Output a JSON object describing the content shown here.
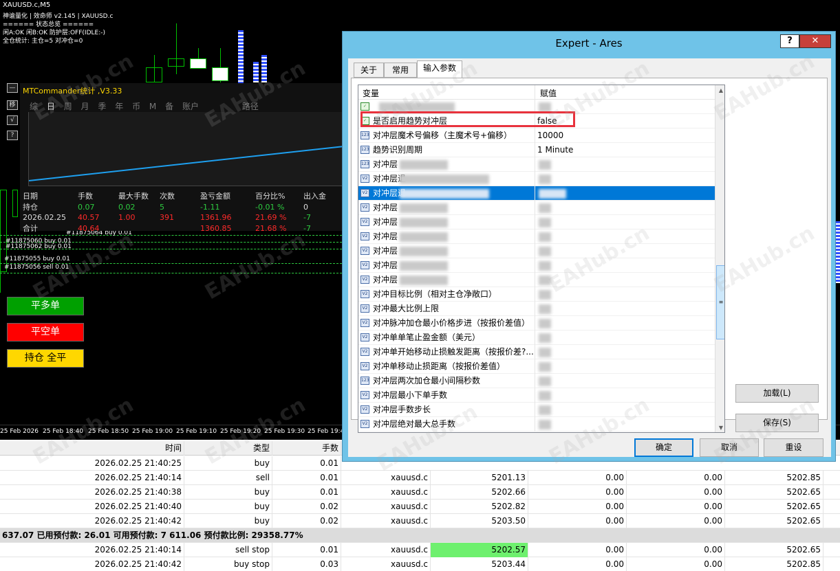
{
  "chart": {
    "title": "XAUUSD.c,M5",
    "info_lines": [
      "神谕量化 | 效命师 v2.145 | XAUUSD.c",
      "====== 状态总览 ======",
      "闲A:OK  闲B:OK  防护层:OFF(IDLE:-)",
      "全仓统计: 主仓=5  对冲仓=0"
    ],
    "side_buttons": [
      "—",
      "移",
      "√",
      "?"
    ],
    "order_labels": [
      "#11875064 buy 0.01",
      "#11875060 buy 0.01",
      "#11875062 buy 0.01",
      "#11875055 buy 0.01",
      "#11875056 sell 0.01"
    ],
    "action_buttons": {
      "close_long": "平多单",
      "close_short": "平空单",
      "close_all": "持仓  全平"
    },
    "time_ticks": [
      "25 Feb 2026",
      "25 Feb 18:40",
      "25 Feb 18:50",
      "25 Feb 19:00",
      "25 Feb 19:10",
      "25 Feb 19:20",
      "25 Feb 19:30",
      "25 Feb 19:4"
    ],
    "colors": {
      "bull": "#00c000",
      "close_long_btn": "#00a000",
      "close_short_btn": "#ff0000",
      "close_all_btn": "#ffd700"
    }
  },
  "stats": {
    "title": "MTCommander统计 ,V3.33",
    "tabs": [
      "综",
      "日",
      "周",
      "月",
      "季",
      "年",
      "币",
      "M",
      "备",
      "账户",
      "",
      "路径"
    ],
    "active_tab": "日",
    "headers": [
      "日期",
      "手数",
      "最大手数",
      "次数",
      "盈亏金额",
      "百分比%",
      "出入金"
    ],
    "rows": [
      {
        "date": "持仓",
        "lots": "0.07",
        "max_lots": "0.02",
        "count": "5",
        "pnl": "-1.11",
        "pct": "-0.01 %",
        "flow": "0"
      },
      {
        "date": "2026.02.25",
        "lots": "40.57",
        "max_lots": "1.00",
        "count": "391",
        "pnl": "1361.96",
        "pct": "21.69 %",
        "flow": "-7"
      },
      {
        "date": "合计",
        "lots": "40.64",
        "max_lots": "",
        "count": "",
        "pnl": "1360.85",
        "pct": "21.68 %",
        "flow": "-7"
      }
    ]
  },
  "trade": {
    "headers": [
      "时间",
      "类型",
      "手数"
    ],
    "rows": [
      {
        "time": "2026.02.25 21:40:25",
        "type": "buy",
        "lots": "0.01",
        "symbol": "",
        "price": "",
        "sl": "",
        "tp": "",
        "cur": ""
      },
      {
        "time": "2026.02.25 21:40:14",
        "type": "sell",
        "lots": "0.01",
        "symbol": "xauusd.c",
        "price": "5201.13",
        "sl": "0.00",
        "tp": "0.00",
        "cur": "5202.85"
      },
      {
        "time": "2026.02.25 21:40:38",
        "type": "buy",
        "lots": "0.01",
        "symbol": "xauusd.c",
        "price": "5202.66",
        "sl": "0.00",
        "tp": "0.00",
        "cur": "5202.65"
      },
      {
        "time": "2026.02.25 21:40:40",
        "type": "buy",
        "lots": "0.02",
        "symbol": "xauusd.c",
        "price": "5202.82",
        "sl": "0.00",
        "tp": "0.00",
        "cur": "5202.65"
      },
      {
        "time": "2026.02.25 21:40:42",
        "type": "buy",
        "lots": "0.02",
        "symbol": "xauusd.c",
        "price": "5203.50",
        "sl": "0.00",
        "tp": "0.00",
        "cur": "5202.65"
      }
    ],
    "summary": "637.07  已用预付款: 26.01  可用预付款: 7 611.06  预付款比例: 29358.77%",
    "pending": [
      {
        "time": "2026.02.25 21:40:14",
        "type": "sell stop",
        "lots": "0.01",
        "symbol": "xauusd.c",
        "price": "5202.57",
        "sl": "0.00",
        "tp": "0.00",
        "cur": "5202.65"
      },
      {
        "time": "2026.02.25 21:40:42",
        "type": "buy stop",
        "lots": "0.03",
        "symbol": "xauusd.c",
        "price": "5203.44",
        "sl": "0.00",
        "tp": "0.00",
        "cur": "5202.85"
      }
    ]
  },
  "dialog": {
    "title": "Expert - Ares",
    "help": "?",
    "close": "✕",
    "tabs": [
      "关于",
      "常用",
      "输入参数"
    ],
    "active_tab": "输入参数",
    "grid_headers": {
      "name": "变量",
      "value": "赋值"
    },
    "params": [
      {
        "icon": "bool",
        "name": "",
        "value": ""
      },
      {
        "icon": "bool",
        "name": "是否启用趋势对冲层",
        "value": "false"
      },
      {
        "icon": "123",
        "name": "对冲层魔术号偏移（主魔术号+偏移）",
        "value": "10000"
      },
      {
        "icon": "123",
        "name": "趋势识别周期",
        "value": "1 Minute"
      },
      {
        "icon": "123",
        "name": "对冲层",
        "value": ""
      },
      {
        "icon": "V2",
        "name": "对冲层退",
        "value": ""
      },
      {
        "icon": "V2",
        "name": "对冲层退",
        "value": ""
      },
      {
        "icon": "V2",
        "name": "对冲层",
        "value": ""
      },
      {
        "icon": "V2",
        "name": "对冲层",
        "value": ""
      },
      {
        "icon": "V2",
        "name": "对冲层",
        "value": ""
      },
      {
        "icon": "V2",
        "name": "对冲层",
        "value": ""
      },
      {
        "icon": "V2",
        "name": "对冲层",
        "value": ""
      },
      {
        "icon": "V2",
        "name": "对冲层",
        "value": ""
      },
      {
        "icon": "V2",
        "name": "对冲目标比例（相对主仓净敞口）",
        "value": ""
      },
      {
        "icon": "V2",
        "name": "对冲最大比例上限",
        "value": ""
      },
      {
        "icon": "V2",
        "name": "对冲脉冲加仓最小价格步进（按报价差值）",
        "value": ""
      },
      {
        "icon": "V2",
        "name": "对冲单单笔止盈金额（美元）",
        "value": ""
      },
      {
        "icon": "V2",
        "name": "对冲单开始移动止损触发距离（按报价差?...",
        "value": ""
      },
      {
        "icon": "V2",
        "name": "对冲单移动止损距离（按报价差值）",
        "value": ""
      },
      {
        "icon": "123",
        "name": "对冲层两次加仓最小间隔秒数",
        "value": ""
      },
      {
        "icon": "V2",
        "name": "对冲层最小下单手数",
        "value": ""
      },
      {
        "icon": "V2",
        "name": "对冲层手数步长",
        "value": ""
      },
      {
        "icon": "V2",
        "name": "对冲层绝对最大总手数",
        "value": ""
      }
    ],
    "selected_param_index": 6,
    "buttons": {
      "load": "加载(L)",
      "save": "保存(S)",
      "ok": "确定",
      "cancel": "取消",
      "reset": "重设"
    },
    "scroll_thumb": "≡"
  },
  "watermark": "EAHub.cn"
}
